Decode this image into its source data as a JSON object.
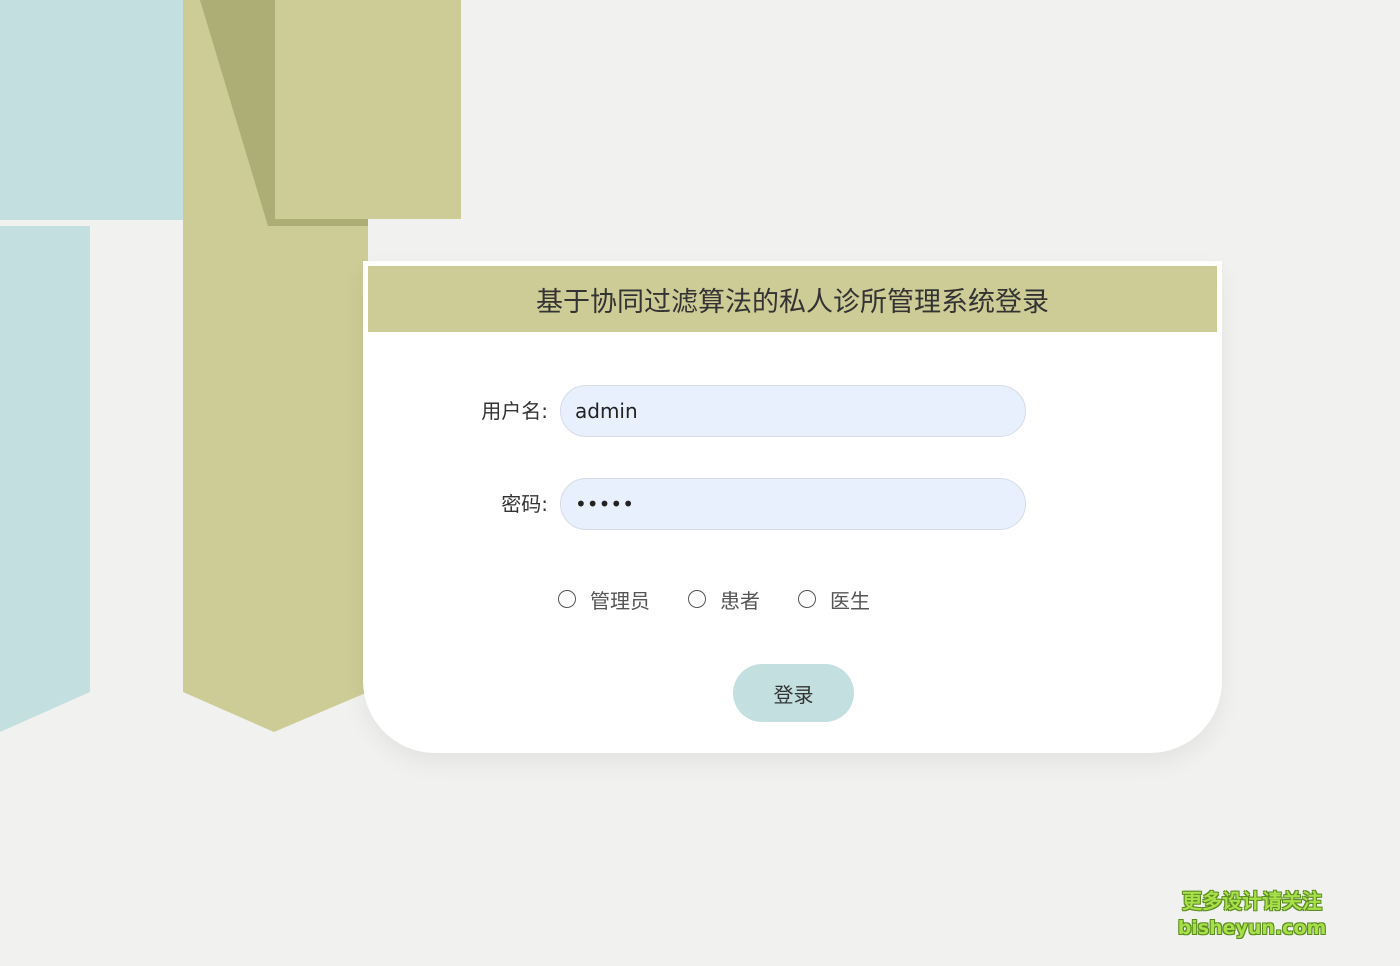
{
  "colors": {
    "background": "#f1f1ef",
    "header_bg": "#cdcc96",
    "teal_ribbon": "#c3dfe0",
    "olive_ribbon": "#cdcc96",
    "olive_dark": "#adad76",
    "input_bg": "#e8f0fe",
    "button_bg": "#c3dfe0",
    "watermark": "#a7e04a"
  },
  "login": {
    "title": "基于协同过滤算法的私人诊所管理系统登录",
    "username_label": "用户名:",
    "username_value": "admin",
    "password_label": "密码:",
    "password_value": "•••••",
    "roles": [
      {
        "label": "管理员",
        "selected": false
      },
      {
        "label": "患者",
        "selected": false
      },
      {
        "label": "医生",
        "selected": false
      }
    ],
    "submit_label": "登录"
  },
  "watermark": {
    "line1": "更多设计请关注",
    "line2": "bisheyun.com"
  }
}
